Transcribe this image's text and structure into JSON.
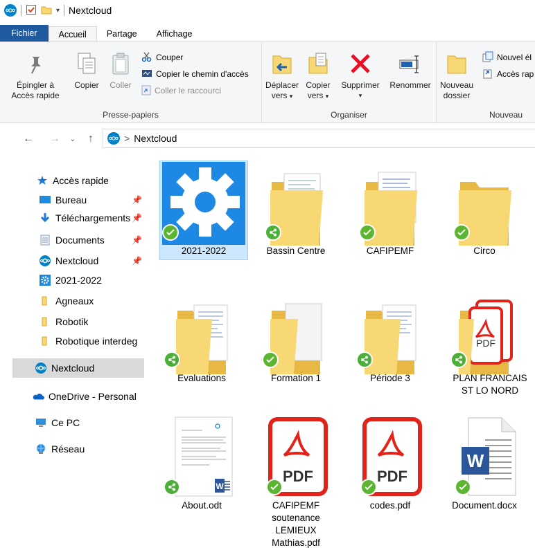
{
  "window": {
    "title": "Nextcloud"
  },
  "tabs": [
    "Fichier",
    "Accueil",
    "Partage",
    "Affichage"
  ],
  "ribbon": {
    "clipboard": {
      "label": "Presse-papiers",
      "pin_line1": "Épingler à",
      "pin_line2": "Accès rapide",
      "copy": "Copier",
      "paste": "Coller",
      "cut": "Couper",
      "copy_path": "Copier le chemin d'accès",
      "paste_shortcut": "Coller le raccourci"
    },
    "organize": {
      "label": "Organiser",
      "move_line1": "Déplacer",
      "move_line2": "vers",
      "copyto_line1": "Copier",
      "copyto_line2": "vers",
      "delete": "Supprimer",
      "rename": "Renommer"
    },
    "new": {
      "label": "Nouveau",
      "folder_line1": "Nouveau",
      "folder_line2": "dossier",
      "new_item": "Nouvel él",
      "easy_access": "Accès rap"
    }
  },
  "address": {
    "location": "Nextcloud",
    "separator": ">"
  },
  "sidebar": {
    "items": [
      {
        "label": "Accès rapide",
        "icon": "star-icon"
      },
      {
        "label": "Bureau",
        "icon": "desktop-icon"
      },
      {
        "label": "Téléchargements",
        "icon": "download-icon"
      },
      {
        "label": "Documents",
        "icon": "documents-icon"
      },
      {
        "label": "Nextcloud",
        "icon": "nextcloud-icon"
      },
      {
        "label": "2021-2022",
        "icon": "gear-folder-icon"
      },
      {
        "label": "Agneaux",
        "icon": "folder-icon"
      },
      {
        "label": "Robotik",
        "icon": "folder-icon"
      },
      {
        "label": "Robotique interdeg",
        "icon": "folder-icon"
      },
      {
        "label": "Nextcloud",
        "icon": "nextcloud-icon"
      },
      {
        "label": "OneDrive - Personal",
        "icon": "cloud-icon"
      },
      {
        "label": "Ce PC",
        "icon": "pc-icon"
      },
      {
        "label": "Réseau",
        "icon": "network-icon"
      }
    ]
  },
  "files": [
    {
      "name": "2021-2022",
      "type": "gear-folder",
      "badge": "ok"
    },
    {
      "name": "Bassin Centre",
      "type": "folder-docs",
      "badge": "share"
    },
    {
      "name": "CAFIPEMF",
      "type": "folder-docs",
      "badge": "ok"
    },
    {
      "name": "Circo",
      "type": "folder",
      "badge": "ok"
    },
    {
      "name": "Evaluations",
      "type": "folder-docs",
      "badge": "share"
    },
    {
      "name": "Formation 1",
      "type": "folder-docs",
      "badge": "ok"
    },
    {
      "name": "Période 3",
      "type": "folder-docs",
      "badge": "share"
    },
    {
      "name_line1": "PLAN FRANCAIS",
      "name_line2": "ST LO NORD",
      "type": "folder-pdf",
      "badge": "share"
    },
    {
      "name": "About.odt",
      "type": "document",
      "badge": "share"
    },
    {
      "name_line1": "CAFIPEMF",
      "name_line2": "soutenance",
      "name_line3": "LEMIEUX",
      "name_line4": "Mathias.pdf",
      "type": "pdf",
      "badge": "ok"
    },
    {
      "name": "codes.pdf",
      "type": "pdf",
      "badge": "ok"
    },
    {
      "name": "Document.docx",
      "type": "word",
      "badge": "ok"
    }
  ],
  "labels": {
    "pdf_text": "PDF",
    "word_letter": "W"
  },
  "colors": {
    "accent": "#1f5a9e",
    "folder": "#f8d775",
    "check_green": "#5cb531",
    "pdf_red": "#e2231a",
    "nextcloud_blue": "#0082c9",
    "selection": "#cce8ff"
  }
}
